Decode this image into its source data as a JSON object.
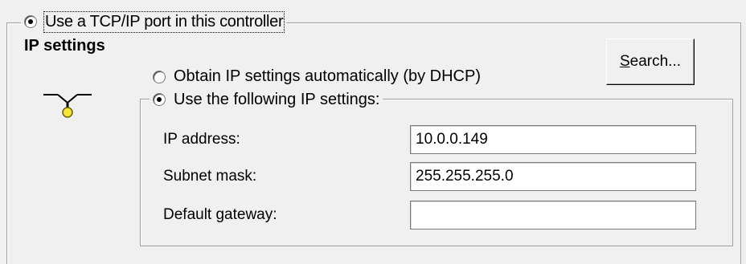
{
  "tcp_port_option": {
    "label": "Use a TCP/IP port in this controller",
    "selected": true
  },
  "ip_settings": {
    "title": "IP settings",
    "icon": "network-port-icon",
    "dhcp_option": {
      "label": "Obtain IP settings automatically (by DHCP)",
      "selected": false
    },
    "manual_option": {
      "label": "Use the following IP settings:",
      "selected": true
    },
    "fields": {
      "ip_address": {
        "label": "IP address:",
        "value": "10.0.0.149"
      },
      "subnet_mask": {
        "label": "Subnet mask:",
        "value": "255.255.255.0"
      },
      "default_gateway": {
        "label": "Default gateway:",
        "value": ""
      }
    },
    "search_button": {
      "mnemonic": "S",
      "rest": "earch..."
    }
  }
}
